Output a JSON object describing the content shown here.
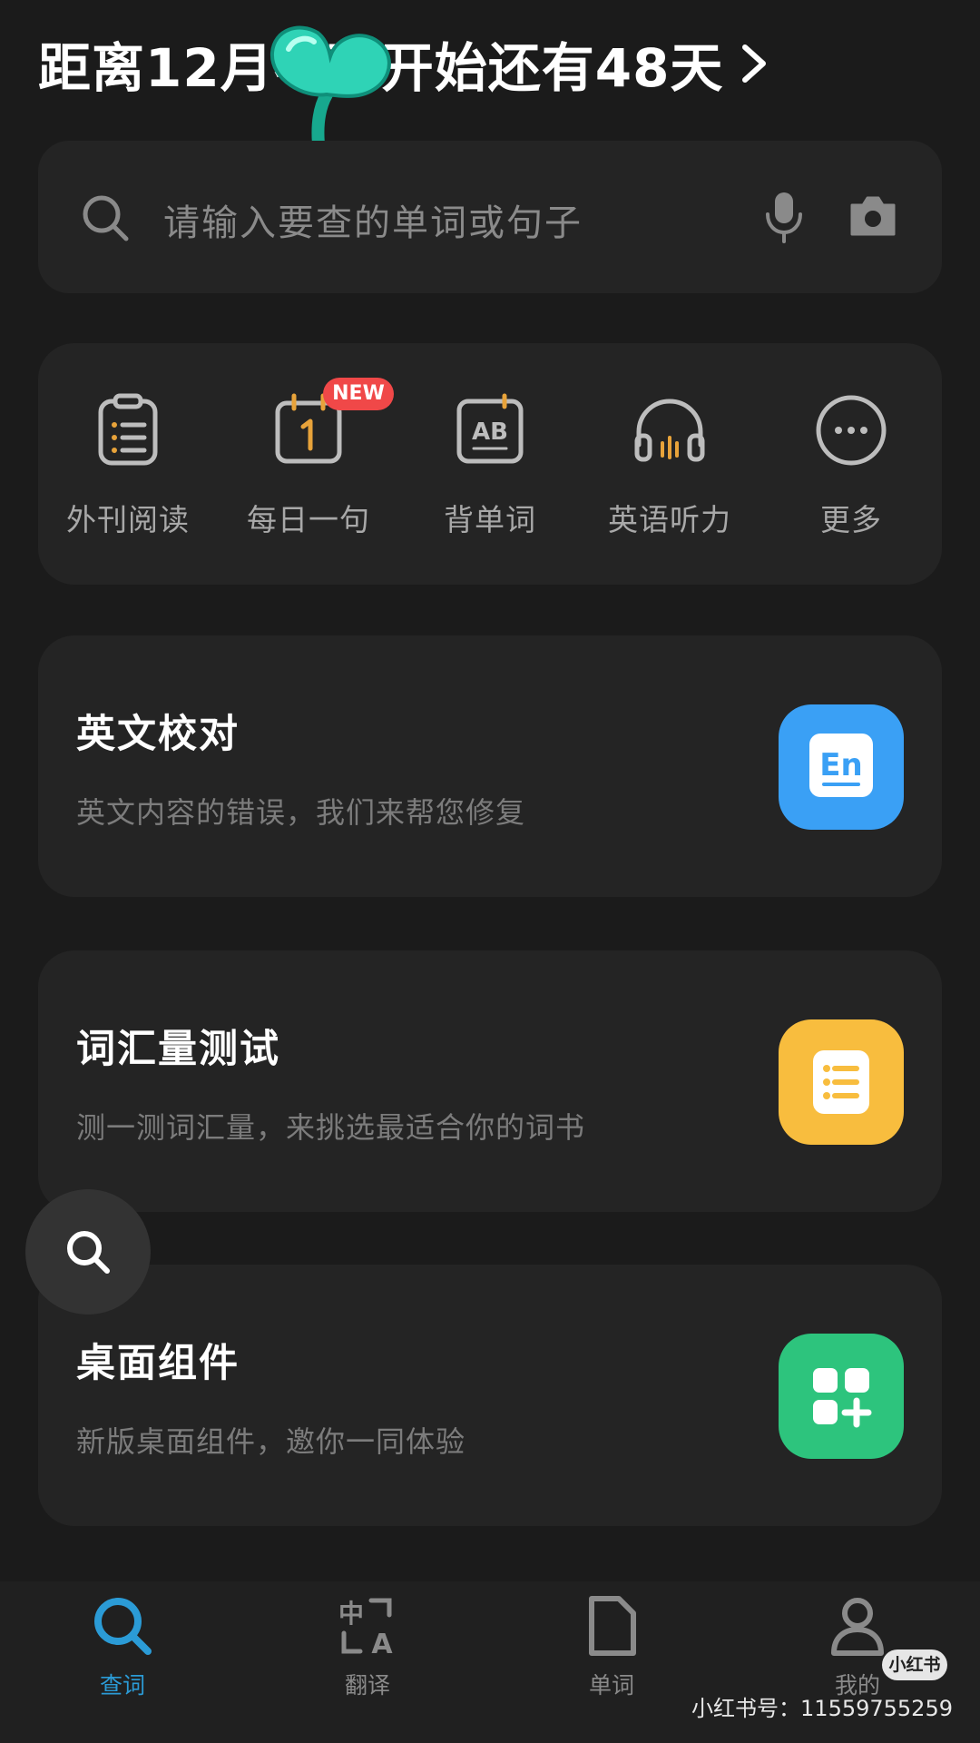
{
  "header": {
    "countdown_text": "距离12月考研开始还有48天"
  },
  "search": {
    "placeholder": "请输入要查的单词或句子"
  },
  "tools": [
    {
      "label": "外刊阅读",
      "icon": "clipboard-icon"
    },
    {
      "label": "每日一句",
      "icon": "calendar-icon",
      "badge": "NEW"
    },
    {
      "label": "背单词",
      "icon": "ab-card-icon"
    },
    {
      "label": "英语听力",
      "icon": "headphones-icon"
    },
    {
      "label": "更多",
      "icon": "more-icon"
    }
  ],
  "features": [
    {
      "title": "英文校对",
      "subtitle": "英文内容的错误，我们来帮您修复",
      "icon": "en-icon",
      "color": "#3aa0f5"
    },
    {
      "title": "词汇量测试",
      "subtitle": "测一测词汇量，来挑选最适合你的词书",
      "icon": "list-icon",
      "color": "#f8bd3e"
    },
    {
      "title": "桌面组件",
      "subtitle": "新版桌面组件，邀你一同体验",
      "icon": "widgets-icon",
      "color": "#2dc47d"
    }
  ],
  "nav": [
    {
      "label": "查词",
      "icon": "search-icon",
      "active": true
    },
    {
      "label": "翻译",
      "icon": "translate-icon",
      "active": false
    },
    {
      "label": "单词",
      "icon": "document-icon",
      "active": false
    },
    {
      "label": "我的",
      "icon": "person-icon",
      "active": false
    }
  ],
  "watermark": {
    "badge": "小红书",
    "text": "小红书号：11559755259"
  },
  "colors": {
    "accent": "#2b9bd6",
    "badge_red": "#f04848",
    "tool_accent": "#e8a33a"
  }
}
